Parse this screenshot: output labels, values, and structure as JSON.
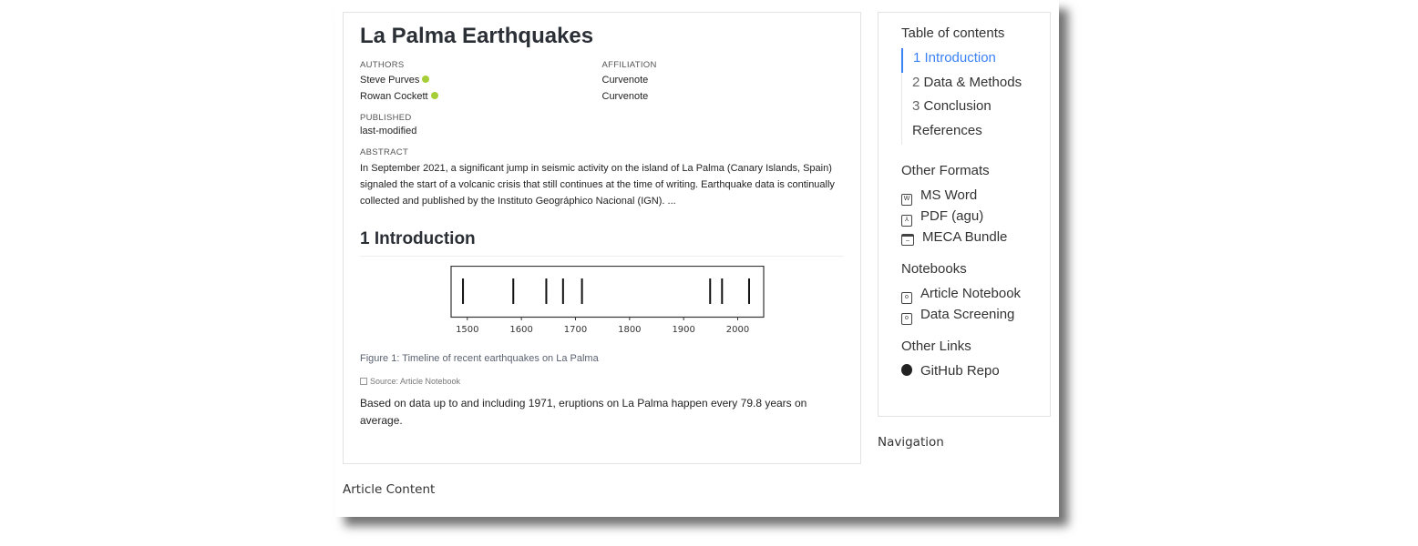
{
  "article": {
    "title": "La Palma Earthquakes",
    "authors_label": "AUTHORS",
    "affiliation_label": "AFFILIATION",
    "authors": [
      {
        "name": "Steve Purves",
        "affiliation": "Curvenote"
      },
      {
        "name": "Rowan Cockett",
        "affiliation": "Curvenote"
      }
    ],
    "published_label": "PUBLISHED",
    "published": "last-modified",
    "abstract_label": "ABSTRACT",
    "abstract": "In September 2021, a significant jump in seismic activity on the island of La Palma (Canary Islands, Spain) signaled the start of a volcanic crisis that still continues at the time of writing. Earthquake data is continually collected and published by the Instituto Geográphico Nacional (IGN). ...",
    "section_heading": "1 Introduction",
    "figure_caption": "Figure 1: Timeline of recent earthquakes on La Palma",
    "source": "Source: Article Notebook",
    "paragraph": "Based on data up to and including 1971, eruptions on La Palma happen every 79.8 years on average."
  },
  "chart_data": {
    "type": "event-timeline",
    "x": [
      1492,
      1585,
      1646,
      1677,
      1712,
      1949,
      1971,
      2021
    ],
    "xlim": [
      1470,
      2048
    ],
    "xticks": [
      1500,
      1600,
      1700,
      1800,
      1900,
      2000
    ],
    "grid": false
  },
  "article_label": "Article Content",
  "nav": {
    "toc_title": "Table of contents",
    "toc": [
      {
        "num": "1",
        "label": "Introduction",
        "active": true
      },
      {
        "num": "2",
        "label": "Data & Methods"
      },
      {
        "num": "3",
        "label": "Conclusion"
      },
      {
        "num": "",
        "label": "References"
      }
    ],
    "formats_title": "Other Formats",
    "formats": [
      {
        "icon": "word-icon",
        "label": "MS Word"
      },
      {
        "icon": "pdf-icon",
        "label": "PDF (agu)"
      },
      {
        "icon": "archive-icon",
        "label": "MECA Bundle"
      }
    ],
    "notebooks_title": "Notebooks",
    "notebooks": [
      {
        "icon": "notebook-icon",
        "label": "Article Notebook"
      },
      {
        "icon": "notebook-icon",
        "label": "Data Screening"
      }
    ],
    "links_title": "Other Links",
    "links": [
      {
        "icon": "github-icon",
        "label": "GitHub Repo"
      }
    ],
    "accent": "#3b82f6"
  },
  "nav_label": "Navigation"
}
